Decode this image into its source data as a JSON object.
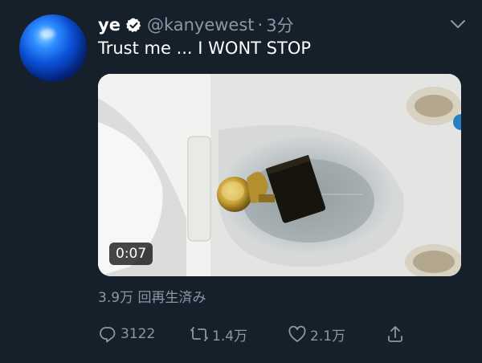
{
  "tweet": {
    "author_name": "ye",
    "handle": "@kanyewest",
    "separator": "·",
    "time": "3分",
    "text": "Trust me ... I WONT STOP",
    "video_duration": "0:07",
    "views": "3.9万 回再生済み",
    "replies": "3122",
    "retweets": "1.4万",
    "likes": "2.1万"
  },
  "icons": {
    "verified": "verified-badge-icon",
    "menu": "chevron-down-icon",
    "reply": "reply-icon",
    "retweet": "retweet-icon",
    "like": "heart-icon",
    "share": "share-icon"
  },
  "colors": {
    "background": "#15202b",
    "text": "#ffffff",
    "secondary": "#8899a6",
    "avatar": "#0b4fd6"
  }
}
